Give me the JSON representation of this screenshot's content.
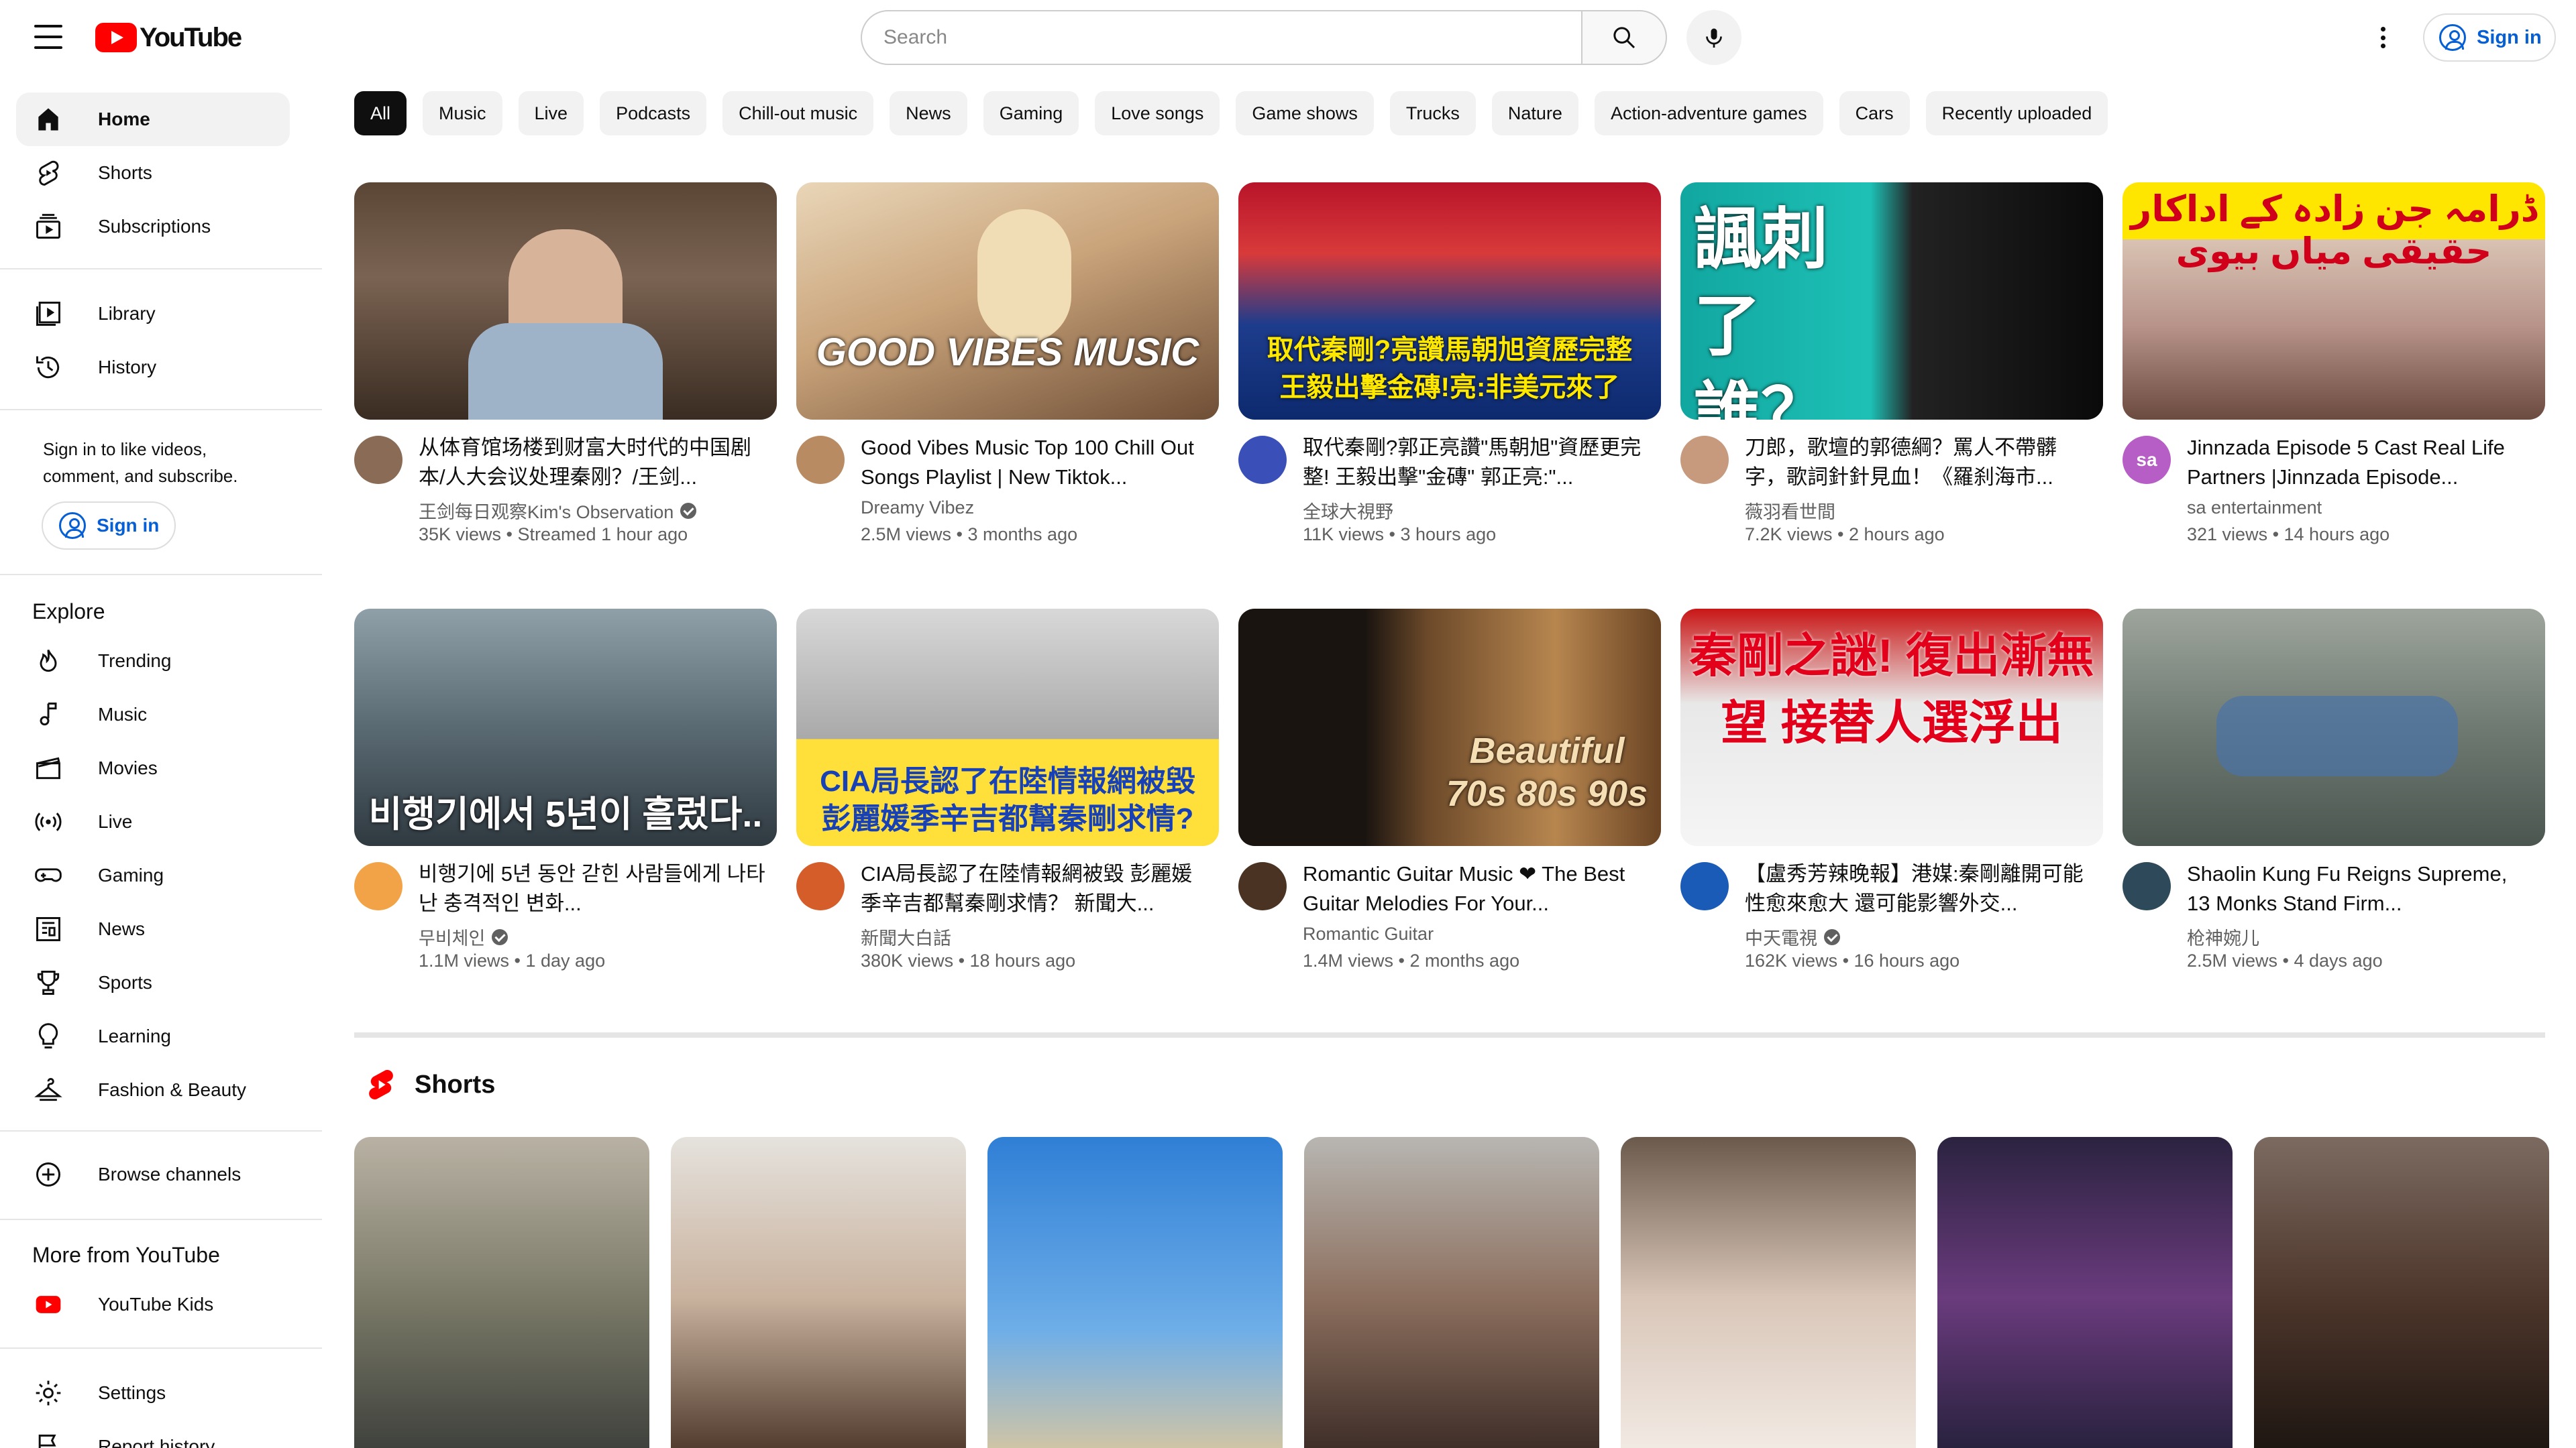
{
  "header": {
    "logo_text": "YouTube",
    "search_placeholder": "Search",
    "signin_label": "Sign in"
  },
  "sidebar": {
    "main": [
      {
        "label": "Home",
        "icon": "home-icon",
        "active": true
      },
      {
        "label": "Shorts",
        "icon": "shorts-icon"
      },
      {
        "label": "Subscriptions",
        "icon": "subscriptions-icon"
      }
    ],
    "library": [
      {
        "label": "Library",
        "icon": "library-icon"
      },
      {
        "label": "History",
        "icon": "history-icon"
      }
    ],
    "signin_note": "Sign in to like videos, comment, and subscribe.",
    "signin_label": "Sign in",
    "explore_heading": "Explore",
    "explore": [
      {
        "label": "Trending",
        "icon": "trending-icon"
      },
      {
        "label": "Music",
        "icon": "music-icon"
      },
      {
        "label": "Movies",
        "icon": "movies-icon"
      },
      {
        "label": "Live",
        "icon": "live-icon"
      },
      {
        "label": "Gaming",
        "icon": "gaming-icon"
      },
      {
        "label": "News",
        "icon": "news-icon"
      },
      {
        "label": "Sports",
        "icon": "sports-icon"
      },
      {
        "label": "Learning",
        "icon": "learning-icon"
      },
      {
        "label": "Fashion & Beauty",
        "icon": "fashion-icon"
      }
    ],
    "browse_channels": "Browse channels",
    "more_heading": "More from YouTube",
    "youtube_kids": "YouTube Kids",
    "settings": "Settings",
    "report_history": "Report history"
  },
  "chips": [
    "All",
    "Music",
    "Live",
    "Podcasts",
    "Chill-out music",
    "News",
    "Gaming",
    "Love songs",
    "Game shows",
    "Trucks",
    "Nature",
    "Action-adventure games",
    "Cars",
    "Recently uploaded"
  ],
  "videos": [
    {
      "title": "从体育馆场楼到财富大时代的中国剧本/人大会议处理秦刚？/王剑...",
      "channel": "王剑每日观察Kim's Observation",
      "verified": true,
      "stats": "35K views • Streamed 1 hour ago",
      "thumb_text": ""
    },
    {
      "title": "Good Vibes Music  Top 100 Chill Out Songs Playlist | New Tiktok...",
      "channel": "Dreamy Vibez",
      "verified": false,
      "stats": "2.5M views • 3 months ago",
      "thumb_text": "GOOD VIBES MUSIC"
    },
    {
      "title": "取代秦剛?郭正亮讚\"馬朝旭\"資歷更完整! 王毅出擊\"金磚\" 郭正亮:\"...",
      "channel": "全球大視野",
      "verified": false,
      "stats": "11K views • 3 hours ago",
      "thumb_text": "取代秦剛?亮讚馬朝旭資歷完整 王毅出擊金磚!亮:非美元來了"
    },
    {
      "title": "刀郎，歌壇的郭德綱？罵人不帶髒字，歌詞針針見血！《羅刹海市...",
      "channel": "薇羽看世間",
      "verified": false,
      "stats": "7.2K views • 2 hours ago",
      "thumb_text": "諷刺 了誰？"
    },
    {
      "title": "Jinnzada Episode 5 Cast Real Life Partners |Jinnzada Episode...",
      "channel": "sa entertainment",
      "verified": false,
      "stats": "321 views • 14 hours ago",
      "thumb_text": "ڈرامہ جن زادہ کے اداکار حقیقی میاں بیوی"
    },
    {
      "title": "비행기에 5년 동안 갇힌 사람들에게 나타난 충격적인 변화...",
      "channel": "무비체인",
      "verified": true,
      "stats": "1.1M views • 1 day ago",
      "thumb_text": "비행기에서 5년이 흘렀다.."
    },
    {
      "title": "CIA局長認了在陸情報網被毀 彭麗媛季辛吉都幫秦剛求情？ 新聞大...",
      "channel": "新聞大白話",
      "verified": false,
      "stats": "380K views • 18 hours ago",
      "thumb_text": "CIA局長認了在陸情報網被毀 彭麗媛季辛吉都幫秦剛求情?"
    },
    {
      "title": "Romantic Guitar Music ❤ The Best Guitar Melodies For Your...",
      "channel": "Romantic Guitar",
      "verified": false,
      "stats": "1.4M views • 2 months ago",
      "thumb_text": "Beautiful 70s 80s 90s"
    },
    {
      "title": "【盧秀芳辣晚報】港媒:秦剛離開可能性愈來愈大 還可能影響外交...",
      "channel": "中天電視",
      "verified": true,
      "stats": "162K views • 16 hours ago",
      "thumb_text": "秦剛之謎! 復出漸無望 接替人選浮出"
    },
    {
      "title": "Shaolin Kung Fu Reigns Supreme, 13 Monks Stand Firm...",
      "channel": "枪神婉儿",
      "verified": false,
      "stats": "2.5M views • 4 days ago",
      "thumb_text": ""
    }
  ],
  "shorts": {
    "heading": "Shorts",
    "count": 7
  },
  "colors": {
    "brand_red": "#ff0000",
    "link_blue": "#065fd4",
    "chip_bg": "#f2f2f2",
    "text": "#0f0f0f",
    "meta_text": "#606060"
  }
}
